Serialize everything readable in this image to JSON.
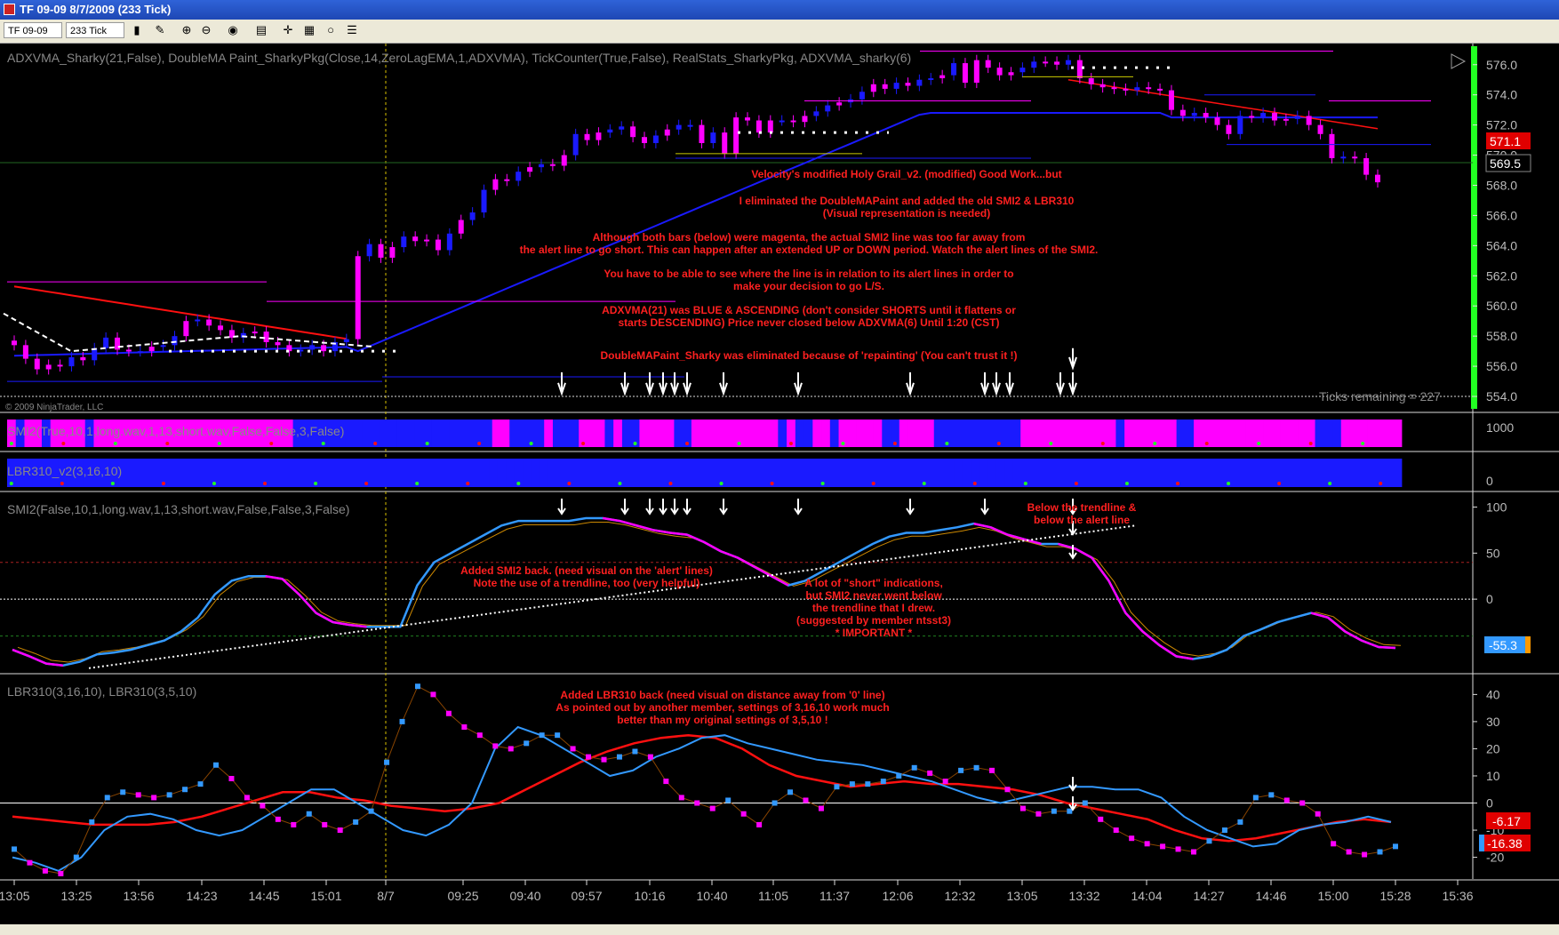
{
  "window": {
    "title": "TF 09-09  8/7/2009 (233 Tick)"
  },
  "toolbar": {
    "instrument": "TF 09-09",
    "period": "233 Tick"
  },
  "colors": {
    "magenta": "#ff00ff",
    "blue": "#1a1aff",
    "red": "#ff1010",
    "lightblue": "#3399ff",
    "orange": "#cc8800",
    "green": "#22ff22",
    "white": "#ffffff"
  },
  "chart_data": [
    {
      "type": "candlestick",
      "title": "ADXVMA_Sharky(21,False),  DoubleMA  Paint_SharkyPkg(Close,14,ZeroLagEMA,1,ADXVMA),  TickCounter(True,False),  RealStats_SharkyPkg,  ADXVMA_sharky(6)",
      "yticks": [
        "576.0",
        "574.0",
        "572.0",
        "570.0",
        "568.0",
        "566.0",
        "564.0",
        "562.0",
        "560.0",
        "558.0",
        "556.0",
        "554.0"
      ],
      "ylim": [
        553.0,
        577.4
      ],
      "closes": [
        557.4,
        556.5,
        555.8,
        556.1,
        556.0,
        556.6,
        556.4,
        557.2,
        557.9,
        557.1,
        557.0,
        557.0,
        557.3,
        557.4,
        558.0,
        559.0,
        559.1,
        558.7,
        558.4,
        557.9,
        558.2,
        558.3,
        557.6,
        557.4,
        557.0,
        557.1,
        557.4,
        557.0,
        557.6,
        557.8,
        563.3,
        564.1,
        563.2,
        563.9,
        564.6,
        564.3,
        564.4,
        563.7,
        564.8,
        565.7,
        566.2,
        567.7,
        568.4,
        568.3,
        568.9,
        569.2,
        569.4,
        569.3,
        570.0,
        571.4,
        571.0,
        571.5,
        571.7,
        571.9,
        571.2,
        570.8,
        571.3,
        571.7,
        572.0,
        572.0,
        570.8,
        571.5,
        570.1,
        572.5,
        572.3,
        571.5,
        572.3,
        572.3,
        572.2,
        572.6,
        572.9,
        573.3,
        573.5,
        573.7,
        574.2,
        574.7,
        574.4,
        574.8,
        574.6,
        575.0,
        575.1,
        575.3,
        576.1,
        574.8,
        576.3,
        575.8,
        575.3,
        575.5,
        575.8,
        576.2,
        576.2,
        576.0,
        576.3,
        575.1,
        574.7,
        574.5,
        574.4,
        574.3,
        574.5,
        574.4,
        574.3,
        573.0,
        572.6,
        572.8,
        572.5,
        572.0,
        571.4,
        572.6,
        572.5,
        572.8,
        572.3,
        572.4,
        572.6,
        572.0,
        571.4,
        569.8,
        569.9,
        569.8,
        568.7,
        568.2
      ],
      "last_price": "571.1",
      "current_price": "569.5",
      "copyright": "© 2009 NinjaTrader, LLC",
      "ticks_remaining": "Ticks remaining = 227",
      "notes": [
        "Velocity's modified Holy Grail_v2. (modified) Good Work...but",
        "I eliminated the DoubleMAPaint and added the old SMI2 & LBR310",
        "(Visual representation is needed)",
        "Although both bars (below) were magenta, the actual SMI2 line was too far away from",
        "the alert line to go short. This can happen after an extended UP or DOWN period.  Watch the alert lines of the SMI2.",
        "You have to be able to see where the line is in relation to its alert lines in order to",
        "make your decision to go L/S.",
        "ADXVMA(21) was BLUE & ASCENDING  (don't consider SHORTS until it flattens or",
        "starts DESCENDING)  Price never closed below ADXVMA(6) Until 1:20 (CST)",
        "DoubleMAPaint_Sharky was eliminated because of 'repainting' (You can't trust it !)"
      ]
    },
    {
      "type": "bar",
      "title": "SMI2(True,10,1,long.wav,1,13,short.wav,False,False,3,False)",
      "ytick": "1000",
      "colors_seq": "MBMMBMMMMBMMMMMMMMMMMMMMMMMMMMMMMBBBBBBBBBBBBBBBBBBBBBBBMMBBBBMBBBMMMBMBBMMMMBBMMMMMMMMMMBMBBMMBMMMMMBBMMMMBBBBBBBBBBMMMMMMMMMMMBMMMMMMBBMMMMMMMMMMMMMMBBBMMMMMMM"
    },
    {
      "type": "bar",
      "title": "LBR310_v2(3,16,10)",
      "ytick": "0",
      "colors_seq": "BBBBBBBBBBBBBBBBBBBBBBBBBBBBBBBBBBBBBBBBBBBBBBBBBBBBBBBBBBBBBBBBBBBBBBBBBBBBBBBBBBBBBBBBBBBBBBBBBBBBBBBBBBBBBBBBBBBBBBBBBBBBBBBBBBBBBBBBBBBBBBBBBBBBBBBBBBBBBBBBBBBBB"
    },
    {
      "type": "line",
      "title": "SMI2(False,10,1,long.wav,1,13,short.wav,False,False,3,False)",
      "yticks": [
        "100",
        "50",
        "0"
      ],
      "ylim": [
        -80,
        115
      ],
      "smi": [
        -55,
        -62,
        -70,
        -72,
        -68,
        -60,
        -58,
        -55,
        -50,
        -45,
        -35,
        -20,
        5,
        20,
        25,
        25,
        22,
        5,
        -15,
        -25,
        -28,
        -30,
        -30,
        -30,
        15,
        40,
        50,
        60,
        70,
        80,
        85,
        85,
        85,
        85,
        88,
        88,
        85,
        80,
        75,
        72,
        70,
        62,
        52,
        45,
        35,
        25,
        15,
        20,
        30,
        40,
        50,
        60,
        68,
        72,
        72,
        75,
        78,
        82,
        78,
        70,
        65,
        60,
        60,
        55,
        45,
        20,
        -15,
        -35,
        -50,
        -62,
        -65,
        -62,
        -55,
        -40,
        -33,
        -25,
        -20,
        -15,
        -20,
        -35,
        -45,
        -52,
        -53
      ],
      "smi_latest": "-55.3",
      "notes": [
        "Added SMI2 back.  (need visual on the 'alert' lines)",
        "Note the use of a trendline, too (very helpful)",
        "A lot of \"short\" indications,",
        "but SMI2 never went below",
        "the trendline that I drew.",
        "(suggested by member ntsst3)",
        "* IMPORTANT *",
        "Below the trendline &",
        "below the alert line"
      ]
    },
    {
      "type": "line",
      "title": "LBR310(3,16,10), LBR310(3,5,10)",
      "yticks": [
        "40",
        "30",
        "20",
        "10",
        "0",
        "-10",
        "-20"
      ],
      "ylim": [
        -28,
        47
      ],
      "dots": [
        -17,
        -22,
        -25,
        -26,
        -20,
        -7,
        2,
        4,
        3,
        2,
        3,
        5,
        7,
        14,
        9,
        2,
        -1,
        -6,
        -8,
        -4,
        -8,
        -10,
        -7,
        -3,
        15,
        30,
        43,
        40,
        33,
        28,
        25,
        21,
        20,
        22,
        25,
        25,
        20,
        17,
        16,
        17,
        19,
        17,
        8,
        2,
        0,
        -2,
        1,
        -4,
        -8,
        0,
        4,
        1,
        -2,
        6,
        7,
        7,
        8,
        10,
        13,
        11,
        8,
        12,
        13,
        12,
        5,
        -2,
        -4,
        -3,
        -3,
        0,
        -6,
        -10,
        -13,
        -15,
        -16,
        -17,
        -18,
        -14,
        -10,
        -7,
        2,
        3,
        1,
        0,
        -4,
        -15,
        -18,
        -19,
        -18,
        -16
      ],
      "red_line": [
        -5,
        -6,
        -7,
        -8,
        -8,
        -8,
        -7,
        -5,
        -2,
        1,
        4,
        4,
        2,
        1,
        -1,
        -2,
        -3,
        -2,
        0,
        5,
        10,
        15,
        19,
        22,
        24,
        25,
        24,
        20,
        14,
        10,
        8,
        6,
        7,
        8,
        7,
        7,
        6,
        5,
        3,
        0,
        -2,
        -4,
        -6,
        -10,
        -13,
        -14,
        -13,
        -11,
        -9,
        -7,
        -6,
        -7
      ],
      "blue_line": [
        -20,
        -22,
        -25,
        -20,
        -10,
        -5,
        -4,
        -6,
        -10,
        -12,
        -10,
        -5,
        0,
        5,
        5,
        0,
        -5,
        -10,
        -12,
        -8,
        0,
        20,
        28,
        25,
        20,
        15,
        10,
        12,
        17,
        20,
        24,
        25,
        22,
        20,
        18,
        16,
        15,
        14,
        12,
        10,
        8,
        5,
        2,
        0,
        2,
        4,
        6,
        6,
        5,
        5,
        2,
        -5,
        -10,
        -13,
        -16,
        -15,
        -10,
        -8,
        -7,
        -5,
        -7
      ],
      "lbr_red": "-6.17",
      "lbr_blue": "-16.38",
      "notes": [
        "Added LBR310 back (need visual on distance away from '0' line)",
        "As pointed out by another member, settings of 3,16,10 work much",
        "better than my original settings of 3,5,10 !"
      ]
    },
    {
      "type": "x-axis",
      "xticks": [
        "13:05",
        "13:25",
        "13:56",
        "14:23",
        "14:45",
        "15:01",
        "8/7",
        "09:25",
        "09:40",
        "09:57",
        "10:16",
        "10:40",
        "11:05",
        "11:37",
        "12:06",
        "12:32",
        "13:05",
        "13:32",
        "14:04",
        "14:27",
        "14:46",
        "15:00",
        "15:28",
        "15:36"
      ]
    }
  ]
}
